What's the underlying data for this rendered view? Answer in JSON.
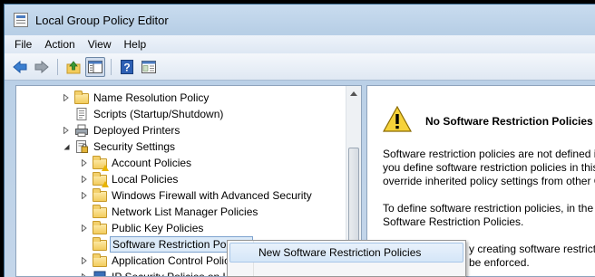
{
  "window": {
    "title": "Local Group Policy Editor"
  },
  "menu": [
    "File",
    "Action",
    "View",
    "Help"
  ],
  "toolbar": {
    "buttons": [
      "back-icon",
      "forward-icon",
      "up-folder-icon",
      "show-hide-tree-icon",
      "help-icon",
      "properties-icon"
    ]
  },
  "tree": {
    "items": [
      {
        "label": "Name Resolution Policy",
        "icon": "folder-icon",
        "expander": "collapsed",
        "level": 0
      },
      {
        "label": "Scripts (Startup/Shutdown)",
        "icon": "script-icon",
        "expander": "none",
        "level": 0
      },
      {
        "label": "Deployed Printers",
        "icon": "printer-icon",
        "expander": "collapsed",
        "level": 0
      },
      {
        "label": "Security Settings",
        "icon": "security-settings-icon",
        "expander": "expanded",
        "level": 0
      },
      {
        "label": "Account Policies",
        "icon": "folder-warning-icon",
        "expander": "collapsed",
        "level": 1
      },
      {
        "label": "Local Policies",
        "icon": "folder-warning-icon",
        "expander": "collapsed",
        "level": 1
      },
      {
        "label": "Windows Firewall with Advanced Security",
        "icon": "folder-icon",
        "expander": "collapsed",
        "level": 1
      },
      {
        "label": "Network List Manager Policies",
        "icon": "folder-icon",
        "expander": "none",
        "level": 1
      },
      {
        "label": "Public Key Policies",
        "icon": "folder-icon",
        "expander": "collapsed",
        "level": 1
      },
      {
        "label": "Software Restriction Policies",
        "icon": "folder-icon",
        "expander": "none",
        "level": 1,
        "selected": true
      },
      {
        "label": "Application Control Polic",
        "icon": "folder-icon",
        "expander": "collapsed",
        "level": 1
      },
      {
        "label": "IP Security Policies on Lo",
        "icon": "ip-security-icon",
        "expander": "collapsed",
        "level": 1
      }
    ]
  },
  "details": {
    "heading": "No Software Restriction Policies Defined",
    "para1": [
      "Software restriction policies are not defined in this Group Policy object. If",
      "you define software restriction policies in this Group Policy object, they will",
      "override inherited policy settings from other Group Policy objects."
    ],
    "para2": [
      "To define software restriction policies, in the Action menu, click New",
      "Software Restriction Policies."
    ],
    "para3_fragment": "y creating software restriction policies",
    "para3_line2": "be enforced."
  },
  "context_menu": {
    "items": [
      "New Software Restriction Policies"
    ]
  }
}
